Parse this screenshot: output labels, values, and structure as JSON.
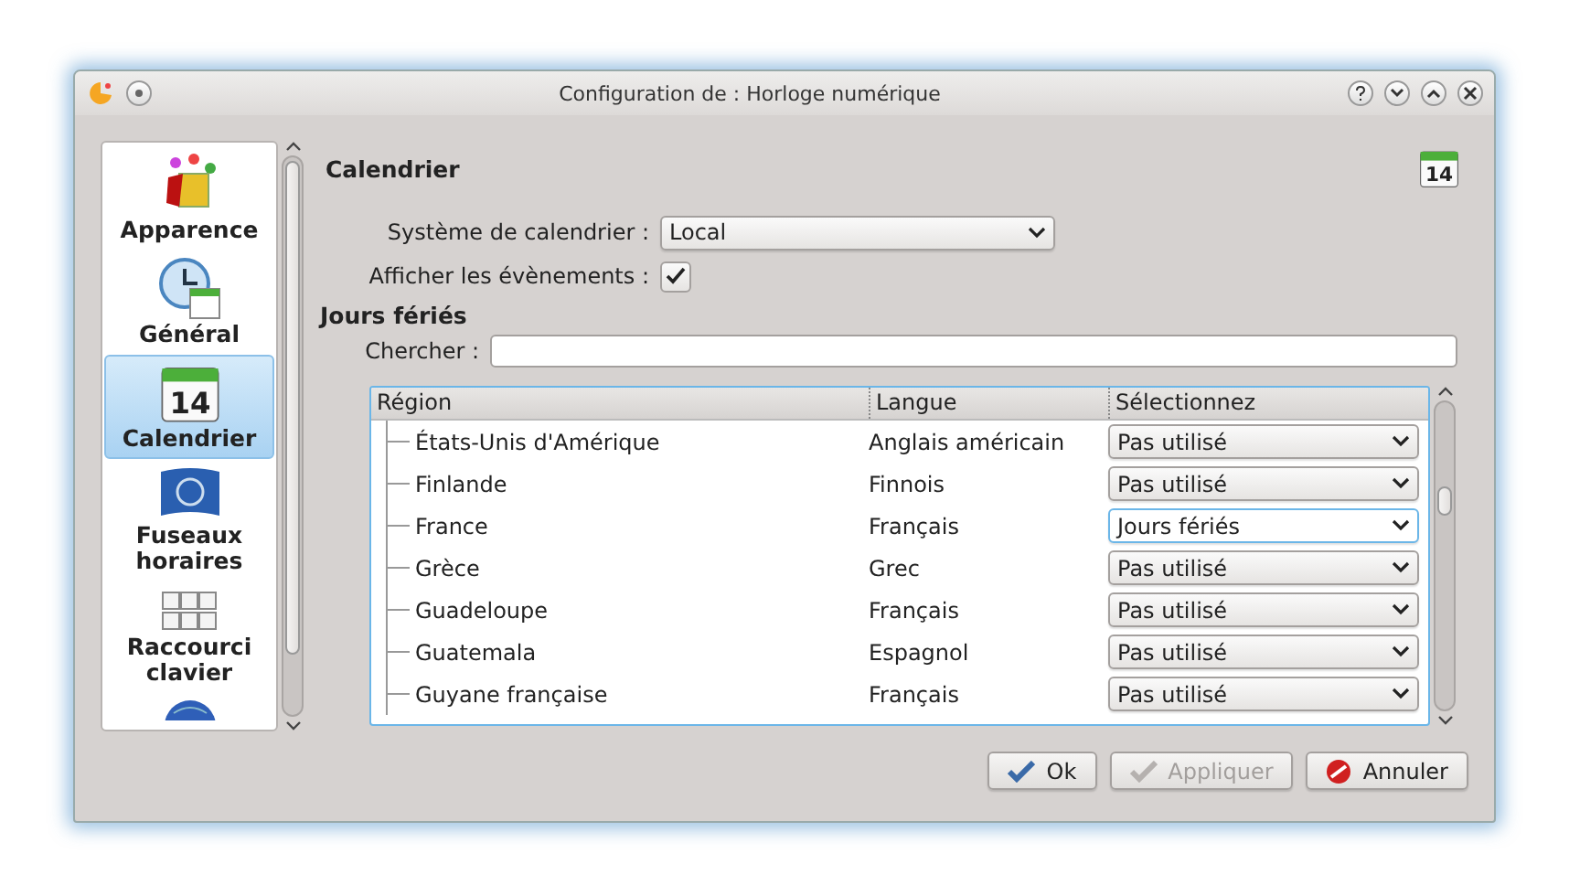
{
  "window": {
    "title": "Configuration de : Horloge numérique"
  },
  "sidebar": {
    "items": [
      {
        "kind": "paint",
        "label": "Apparence",
        "selected": false
      },
      {
        "kind": "clock",
        "label": "Général",
        "selected": false
      },
      {
        "kind": "calendar",
        "label": "Calendrier",
        "selected": true,
        "icon_text": "14"
      },
      {
        "kind": "flag",
        "label": "Fuseaux horaires",
        "selected": false
      },
      {
        "kind": "keyboard",
        "label": "Raccourci clavier",
        "selected": false
      },
      {
        "kind": "globe",
        "selected": false
      }
    ]
  },
  "page": {
    "title": "Calendrier",
    "icon_text": "14"
  },
  "calendar_system": {
    "label": "Système de calendrier :",
    "value": "Local"
  },
  "show_events": {
    "label": "Afficher les évènements :",
    "checked": true
  },
  "holidays": {
    "heading": "Jours fériés",
    "search_label": "Chercher :"
  },
  "table": {
    "columns": [
      "Région",
      "Langue",
      "Sélectionnez"
    ],
    "rows": [
      {
        "region": "États-Unis d'Amérique",
        "language": "Anglais américain",
        "choice": "Pas utilisé",
        "focused": false
      },
      {
        "region": "Finlande",
        "language": "Finnois",
        "choice": "Pas utilisé",
        "focused": false
      },
      {
        "region": "France",
        "language": "Français",
        "choice": "Jours fériés",
        "focused": true
      },
      {
        "region": "Grèce",
        "language": "Grec",
        "choice": "Pas utilisé",
        "focused": false
      },
      {
        "region": "Guadeloupe",
        "language": "Français",
        "choice": "Pas utilisé",
        "focused": false
      },
      {
        "region": "Guatemala",
        "language": "Espagnol",
        "choice": "Pas utilisé",
        "focused": false
      },
      {
        "region": "Guyane française",
        "language": "Français",
        "choice": "Pas utilisé",
        "focused": false
      }
    ]
  },
  "buttons": [
    {
      "kind": "ok",
      "label": "Ok",
      "disabled": false
    },
    {
      "kind": "apply",
      "label": "Appliquer",
      "disabled": true
    },
    {
      "kind": "cancel",
      "label": "Annuler",
      "disabled": false
    }
  ]
}
